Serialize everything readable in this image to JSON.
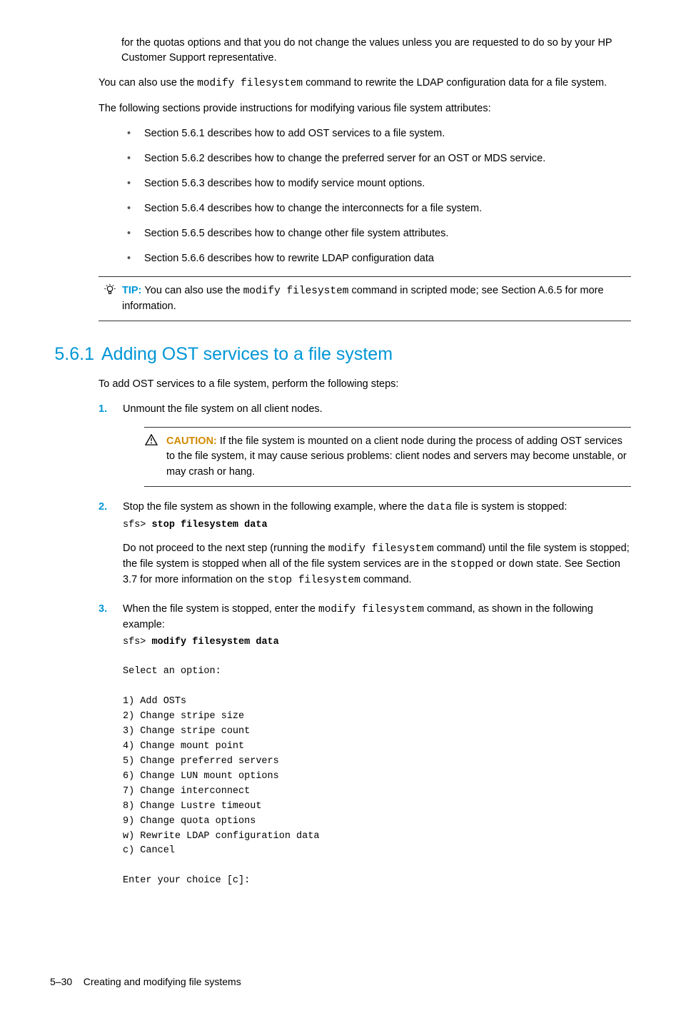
{
  "para_intro": "for the quotas options and that you do not change the values unless you are requested to do so by your HP Customer Support representative.",
  "para_rewrite_pre": "You can also use the ",
  "cmd_modify": "modify filesystem",
  "para_rewrite_post": " command to rewrite the LDAP configuration data for a file system.",
  "para_sections_intro": "The following sections provide instructions for modifying various file system attributes:",
  "toc": [
    "Section 5.6.1 describes how to add OST services to a file system.",
    "Section 5.6.2 describes how to change the preferred server for an OST or MDS service.",
    "Section 5.6.3 describes how to modify service mount options.",
    "Section 5.6.4 describes how to change the interconnects for a file system.",
    "Section 5.6.5 describes how to change other file system attributes.",
    "Section 5.6.6 describes how to rewrite LDAP configuration data"
  ],
  "tip": {
    "label": "TIP:  ",
    "pre": "You can also use the ",
    "cmd": "modify filesystem",
    "post": " command in scripted mode; see Section A.6.5 for more information."
  },
  "heading": {
    "num": "5.6.1",
    "title": "Adding OST services to a file system"
  },
  "para_addintro": "To add OST services to a file system, perform the following steps:",
  "step1": "Unmount the file system on all client nodes.",
  "caution": {
    "label": "CAUTION:  ",
    "text": "If the file system is mounted on a client node during the process of adding OST services to the file system, it may cause serious problems: client nodes and servers may become unstable, or may crash or hang."
  },
  "step2": {
    "pre": "Stop the file system as shown in the following example, where the ",
    "mono1": "data",
    "post": " file is system is stopped:",
    "prompt": "sfs> ",
    "cmd": "stop filesystem data",
    "p2_a": "Do not proceed to the next step (running the ",
    "p2_cmd1": "modify filesystem",
    "p2_b": " command) until the file system is stopped; the file system is stopped when all of the file system services are in the ",
    "p2_cmd2": "stopped",
    "p2_c": " or ",
    "p2_cmd3": "down",
    "p2_d": " state. See Section 3.7 for more information on the ",
    "p2_cmd4": "stop filesystem",
    "p2_e": " command."
  },
  "step3": {
    "pre": "When the file system is stopped, enter the ",
    "cmd": "modify filesystem",
    "post": " command, as shown in the following example:",
    "prompt": "sfs> ",
    "cmdline": "modify filesystem data",
    "menu": "Select an option:\n\n1) Add OSTs\n2) Change stripe size\n3) Change stripe count\n4) Change mount point\n5) Change preferred servers\n6) Change LUN mount options\n7) Change interconnect\n8) Change Lustre timeout\n9) Change quota options\nw) Rewrite LDAP configuration data\nc) Cancel\n\nEnter your choice [c]:"
  },
  "footer": {
    "page": "5–30",
    "title": "Creating and modifying file systems"
  }
}
